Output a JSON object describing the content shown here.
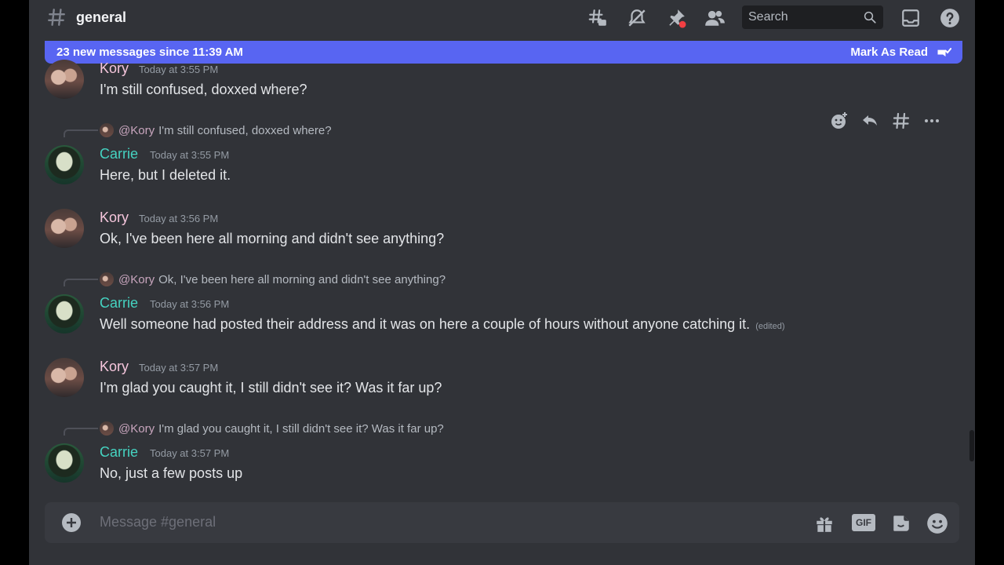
{
  "header": {
    "channel": "general",
    "search_placeholder": "Search"
  },
  "new_messages_bar": {
    "text": "23 new messages since 11:39 AM",
    "mark_read": "Mark As Read"
  },
  "messages": [
    {
      "user": "Kory",
      "time": "Today at 3:55 PM",
      "text": "I'm still confused, doxxed where?"
    },
    {
      "user": "Carrie",
      "time": "Today at 3:55 PM",
      "reply_to": "@Kory",
      "reply_text": "I'm still confused, doxxed where?",
      "text": "Here, but I deleted it."
    },
    {
      "user": "Kory",
      "time": "Today at 3:56 PM",
      "text": "Ok, I've been here all morning and didn't see anything?"
    },
    {
      "user": "Carrie",
      "time": "Today at 3:56 PM",
      "reply_to": "@Kory",
      "reply_text": "Ok, I've been here all morning and didn't see anything?",
      "text": "Well someone had posted their address and it was on here a couple of hours without anyone catching it.",
      "edited": "(edited)"
    },
    {
      "user": "Kory",
      "time": "Today at 3:57 PM",
      "text": "I'm glad you caught it, I still didn't see it? Was it far up?"
    },
    {
      "user": "Carrie",
      "time": "Today at 3:57 PM",
      "reply_to": "@Kory",
      "reply_text": "I'm glad you caught it, I still didn't see it? Was it far up?",
      "text": "No, just a few posts up"
    }
  ],
  "composer": {
    "placeholder": "Message #general",
    "gif_label": "GIF"
  },
  "colors": {
    "background": "#313338",
    "accent": "#5865f2",
    "kory": "#f5c6dc",
    "carrie": "#45d3c1"
  },
  "icons": [
    "hash-icon",
    "threads-icon",
    "mute-icon",
    "pin-icon",
    "members-icon",
    "search-icon",
    "inbox-icon",
    "help-icon",
    "mark-read-icon",
    "add-reaction-icon",
    "reply-icon",
    "create-thread-icon",
    "more-icon",
    "plus-icon",
    "gift-icon",
    "gif-icon",
    "sticker-icon",
    "emoji-icon"
  ]
}
